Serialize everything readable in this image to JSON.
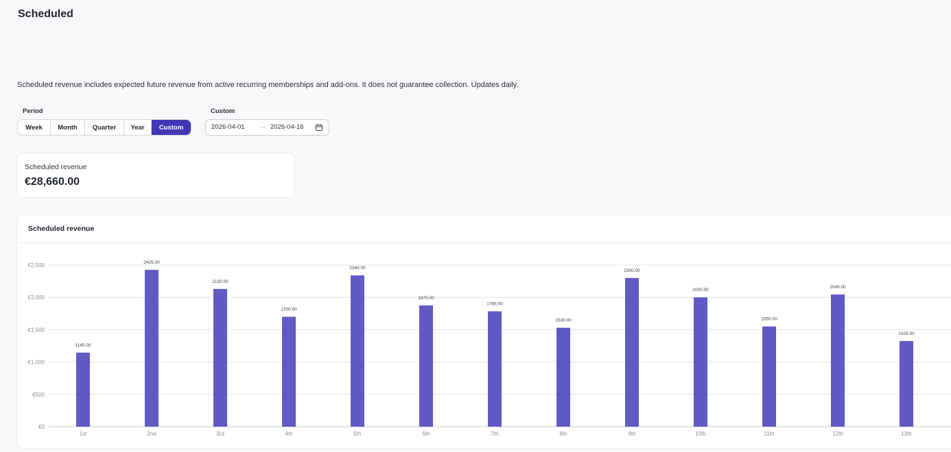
{
  "page": {
    "title": "Scheduled",
    "description": "Scheduled revenue includes expected future revenue from active recurring memberships and add-ons. It does not guarantee collection. Updates daily."
  },
  "period": {
    "label": "Period",
    "options": [
      "Week",
      "Month",
      "Quarter",
      "Year",
      "Custom"
    ],
    "selected": "Custom"
  },
  "custom": {
    "label": "Custom",
    "start": "2026-04-01",
    "separator": "→",
    "end": "2026-04-16",
    "icon": "calendar-icon"
  },
  "kpi": {
    "label": "Scheduled revenue",
    "value": "€28,660.00"
  },
  "chart": {
    "title": "Scheduled revenue"
  },
  "colors": {
    "accent": "#4237b3",
    "bar": "#6159c4"
  },
  "chart_data": {
    "type": "bar",
    "categories": [
      "1st",
      "2nd",
      "3rd",
      "4th",
      "5th",
      "6th",
      "7th",
      "8th",
      "9th",
      "10th",
      "11th",
      "12th",
      "13th"
    ],
    "values": [
      1145,
      2425,
      2130,
      1700,
      2340,
      1875,
      1785,
      1530,
      2300,
      2000,
      1550,
      2045,
      1325
    ],
    "data_labels": [
      "1145.00",
      "2425.00",
      "2130.00",
      "1700.00",
      "2340.00",
      "1875.00",
      "1785.00",
      "1530.00",
      "2300.00",
      "2000.00",
      "1550.00",
      "2045.00",
      "1325.00"
    ],
    "y_ticks": [
      0,
      500,
      1000,
      1500,
      2000,
      2500
    ],
    "y_tick_labels": [
      "€0",
      "€500",
      "€1,000",
      "€1,500",
      "€2,000",
      "€2,500"
    ],
    "ylim": [
      0,
      2500
    ],
    "title": "Scheduled revenue",
    "xlabel": "",
    "ylabel": "",
    "grid": true
  }
}
